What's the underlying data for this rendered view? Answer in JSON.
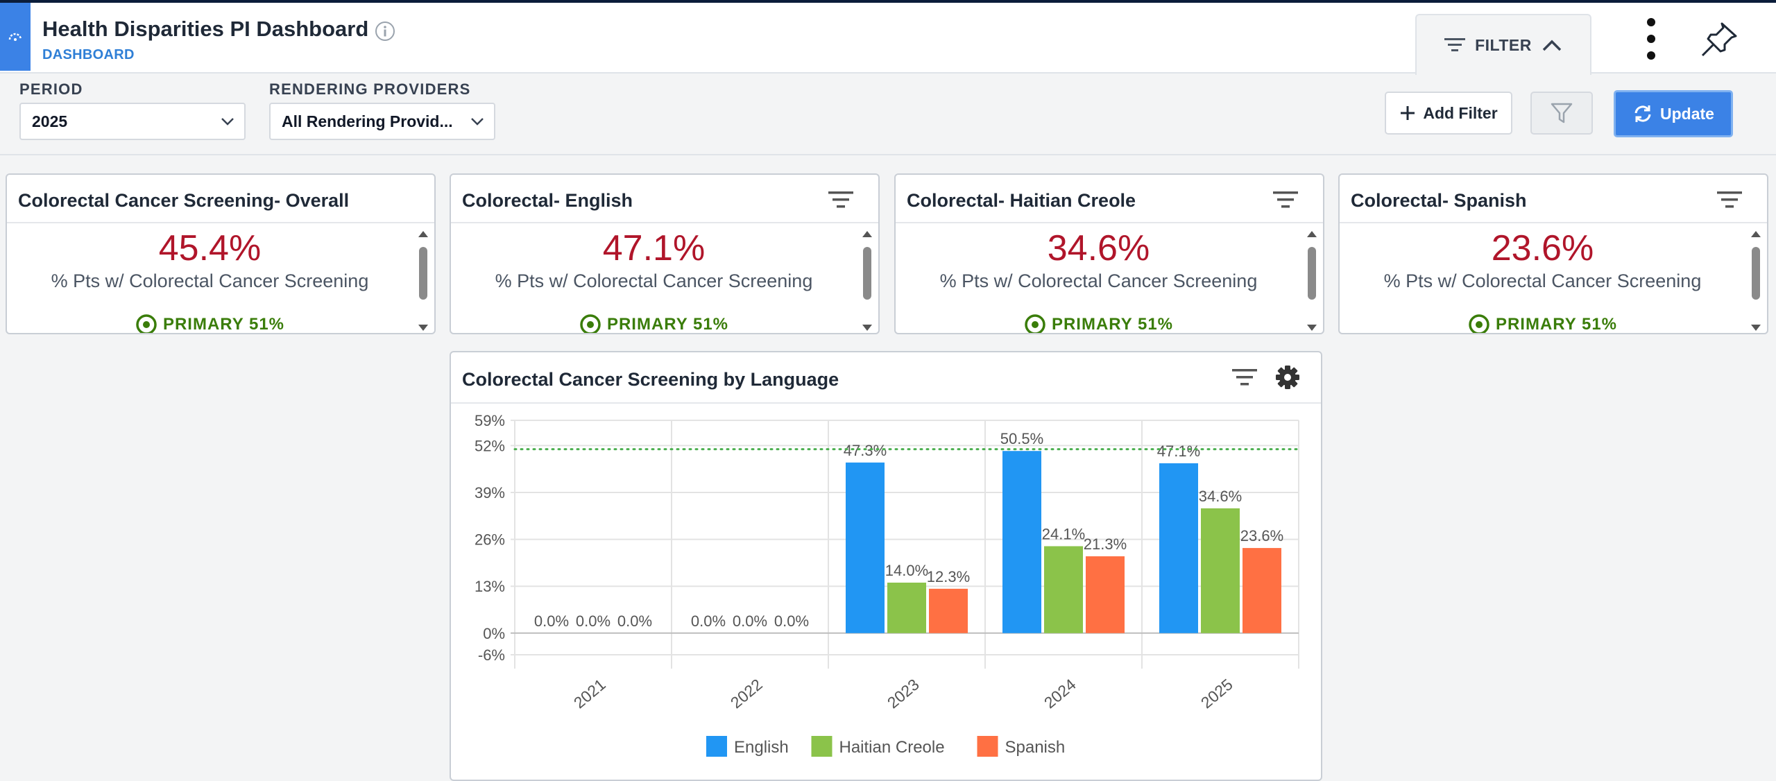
{
  "header": {
    "title": "Health Disparities PI Dashboard",
    "subtitle": "DASHBOARD",
    "filter_tab_label": "FILTER"
  },
  "filters": {
    "period": {
      "label": "PERIOD",
      "value": "2025"
    },
    "providers": {
      "label": "RENDERING PROVIDERS",
      "value": "All Rendering Provid..."
    },
    "add_filter_label": "Add Filter",
    "update_label": "Update"
  },
  "cards": [
    {
      "title": "Colorectal Cancer Screening- Overall",
      "value": "45.4%",
      "description": "% Pts w/ Colorectal Cancer Screening",
      "goal": "PRIMARY 51%",
      "has_filter": false
    },
    {
      "title": "Colorectal- English",
      "value": "47.1%",
      "description": "% Pts w/ Colorectal Cancer Screening",
      "goal": "PRIMARY 51%",
      "has_filter": true
    },
    {
      "title": "Colorectal- Haitian Creole",
      "value": "34.6%",
      "description": "% Pts w/ Colorectal Cancer Screening",
      "goal": "PRIMARY 51%",
      "has_filter": true
    },
    {
      "title": "Colorectal- Spanish",
      "value": "23.6%",
      "description": "% Pts w/ Colorectal Cancer Screening",
      "goal": "PRIMARY 51%",
      "has_filter": true
    }
  ],
  "chart_card": {
    "title": "Colorectal Cancer Screening by Language"
  },
  "colors": {
    "accent": "#3b82e6",
    "value_red": "#b0152a",
    "goal_green": "#3a7d0a",
    "english": "#2196f3",
    "haitian_creole": "#8bc34a",
    "spanish": "#ff7043",
    "goal_line": "#4caf50"
  },
  "chart_data": {
    "type": "bar",
    "categories": [
      "2021",
      "2022",
      "2023",
      "2024",
      "2025"
    ],
    "series": [
      {
        "name": "English",
        "values": [
          0.0,
          0.0,
          47.3,
          50.5,
          47.1
        ],
        "labels": [
          "0.0%",
          "0.0%",
          "47.3%",
          "50.5%",
          "47.1%"
        ]
      },
      {
        "name": "Haitian Creole",
        "values": [
          0.0,
          0.0,
          14.0,
          24.1,
          34.6
        ],
        "labels": [
          "0.0%",
          "0.0%",
          "14.0%",
          "24.1%",
          "34.6%"
        ]
      },
      {
        "name": "Spanish",
        "values": [
          0.0,
          0.0,
          12.3,
          21.3,
          23.6
        ],
        "labels": [
          "0.0%",
          "0.0%",
          "12.3%",
          "21.3%",
          "23.6%"
        ]
      }
    ],
    "y_ticks": [
      "-6%",
      "0%",
      "13%",
      "26%",
      "39%",
      "52%",
      "59%"
    ],
    "y_tick_values": [
      -6,
      0,
      13,
      26,
      39,
      52,
      59
    ],
    "ylim": [
      -6,
      59
    ],
    "goal_line": 51,
    "grid": true,
    "legend_position": "bottom"
  }
}
